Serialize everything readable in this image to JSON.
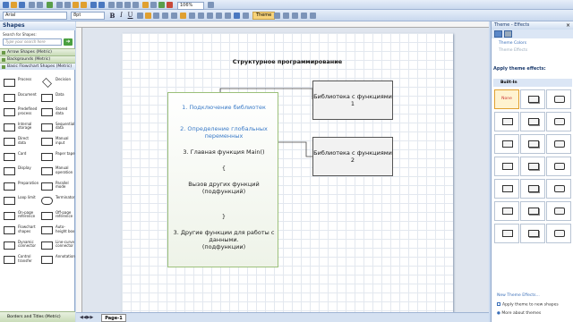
{
  "toolbar": {
    "font_name": "Arial",
    "font_size": "8pt",
    "bold": "B",
    "italic": "I",
    "underline": "U",
    "zoom": "106%",
    "theme_label": "Theme"
  },
  "shapes_panel": {
    "title": "Shapes",
    "search_label": "Search for Shapes:",
    "search_placeholder": "Type your search here",
    "stencils": [
      "Arrow Shapes (Metric)",
      "Backgrounds (Metric)",
      "Basic Flowchart Shapes (Metric)"
    ],
    "shapes": [
      "Process",
      "Decision",
      "Document",
      "Data",
      "Predefined process",
      "Stored data",
      "Internal storage",
      "Sequential data",
      "Direct data",
      "Manual input",
      "Card",
      "Paper tape",
      "Display",
      "Manual operation",
      "Preparation",
      "Parallel mode",
      "Loop limit",
      "Terminator",
      "On-page reference",
      "Off-page reference",
      "Flowchart shapes",
      "Auto-height box",
      "Dynamic connector",
      "Line-curve connector",
      "Control transfer",
      "Annotation"
    ],
    "footer_stencil": "Borders and Titles (Metric)"
  },
  "diagram": {
    "title": "Структурное программирование",
    "main_box": {
      "line1": "1. Подключение библиотек",
      "line2": "2. Определение глобальных",
      "line2b": "переменных",
      "line3": "3. Главная функция Main()",
      "brace_open": "{",
      "line4": "Вызов других функций",
      "line4b": "(подфункций)",
      "brace_close": "}",
      "line5": "3. Другие функции для работы с",
      "line5b": "данными.",
      "line5c": "(подфункции)"
    },
    "library1": "Библиотека с функциями 1",
    "library2": "Библиотека с функциями 2"
  },
  "page_tab": "Page-1",
  "theme_panel": {
    "title": "Theme - Effects",
    "theme_colors": "Theme Colors",
    "theme_effects": "Theme Effects",
    "apply_label": "Apply theme effects:",
    "builtin": "Built-In",
    "first_effect": "None",
    "new_effects": "New Theme Effects...",
    "apply_new": "Apply theme to new shapes",
    "more": "More about themes"
  },
  "colors": {
    "accent": "#3b7bc8",
    "box_border": "#9cc07a"
  }
}
